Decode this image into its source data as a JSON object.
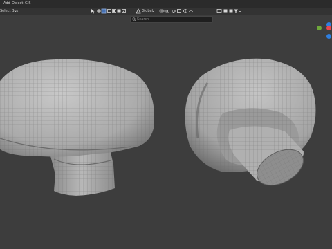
{
  "menubar": {
    "items": [
      {
        "label": "Add"
      },
      {
        "label": "Object"
      },
      {
        "label": "GIS"
      }
    ]
  },
  "toolbar": {
    "select_label": "Select Box",
    "pivot_label": "Global",
    "search_placeholder": "Search"
  },
  "viewport": {
    "background": "#3d3d3d",
    "mesh_color": "#b4b4b4"
  },
  "axes": {
    "x_color": "#e8474f",
    "y_color": "#6fa83b",
    "z_color": "#2e7fe0"
  }
}
